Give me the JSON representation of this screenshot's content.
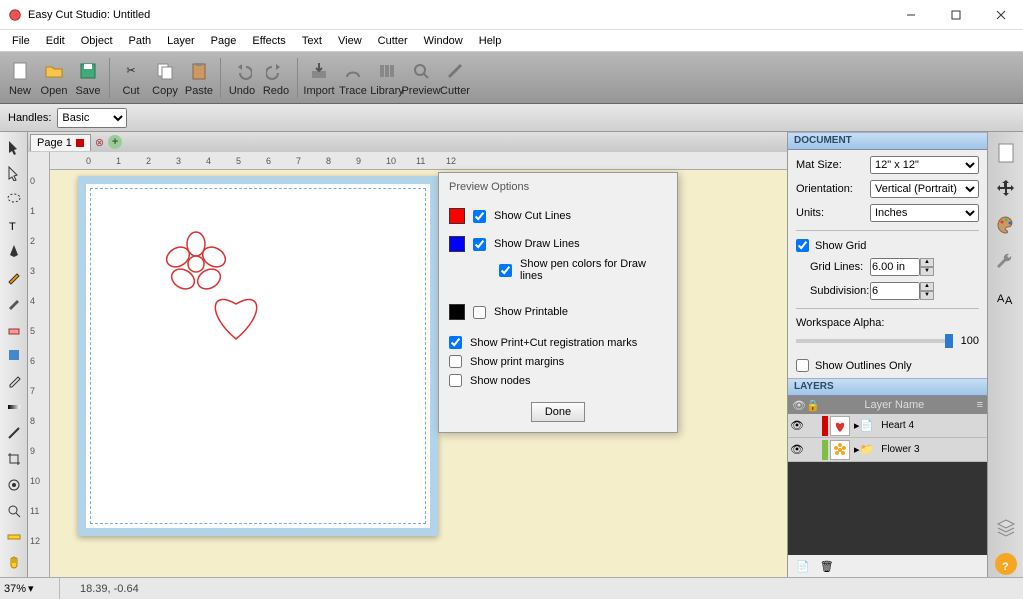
{
  "window": {
    "title": "Easy Cut Studio: Untitled"
  },
  "menu": [
    "File",
    "Edit",
    "Object",
    "Path",
    "Layer",
    "Page",
    "Effects",
    "Text",
    "View",
    "Cutter",
    "Window",
    "Help"
  ],
  "toolbar": [
    {
      "label": "New",
      "icon": "file"
    },
    {
      "label": "Open",
      "icon": "folder"
    },
    {
      "label": "Save",
      "icon": "disk"
    },
    {
      "sep": true
    },
    {
      "label": "Cut",
      "icon": "cut"
    },
    {
      "label": "Copy",
      "icon": "copy"
    },
    {
      "label": "Paste",
      "icon": "paste"
    },
    {
      "sep": true
    },
    {
      "label": "Undo",
      "icon": "undo"
    },
    {
      "label": "Redo",
      "icon": "redo"
    },
    {
      "sep": true
    },
    {
      "label": "Import",
      "icon": "import"
    },
    {
      "label": "Trace",
      "icon": "trace"
    },
    {
      "label": "Library",
      "icon": "library"
    },
    {
      "label": "Preview",
      "icon": "preview"
    },
    {
      "label": "Cutter",
      "icon": "cutter"
    }
  ],
  "handles": {
    "label": "Handles:",
    "value": "Basic"
  },
  "tabs": {
    "page": "Page 1"
  },
  "hruler_ticks": [
    "0",
    "1",
    "2",
    "3",
    "4",
    "5",
    "6",
    "7",
    "8",
    "9",
    "10",
    "11",
    "12"
  ],
  "vruler_ticks": [
    "0",
    "1",
    "2",
    "3",
    "4",
    "5",
    "6",
    "7",
    "8",
    "9",
    "10",
    "11",
    "12"
  ],
  "dialog": {
    "title": "Preview Options",
    "show_cut_lines": "Show Cut Lines",
    "show_draw_lines": "Show Draw Lines",
    "show_pen_colors": "Show pen colors for Draw lines",
    "show_printable": "Show Printable",
    "show_reg_marks": "Show Print+Cut registration marks",
    "show_margins": "Show print margins",
    "show_nodes": "Show nodes",
    "done": "Done"
  },
  "document": {
    "header": "DOCUMENT",
    "mat_size_label": "Mat Size:",
    "mat_size_value": "12\" x 12\"",
    "orientation_label": "Orientation:",
    "orientation_value": "Vertical (Portrait)",
    "units_label": "Units:",
    "units_value": "Inches",
    "show_grid": "Show Grid",
    "grid_lines_label": "Grid Lines:",
    "grid_lines_value": "6.00 in",
    "subdivision_label": "Subdivision:",
    "subdivision_value": "6",
    "workspace_alpha_label": "Workspace Alpha:",
    "workspace_alpha_value": "100",
    "show_outlines": "Show Outlines Only"
  },
  "layers": {
    "header": "LAYERS",
    "col_name": "Layer Name",
    "rows": [
      {
        "color": "#d40000",
        "name": "Heart 4",
        "thumb": "heart"
      },
      {
        "color": "#7fbf3f",
        "name": "Flower 3",
        "thumb": "flower"
      }
    ]
  },
  "status": {
    "zoom": "37%",
    "coords": "18.39, -0.64"
  }
}
